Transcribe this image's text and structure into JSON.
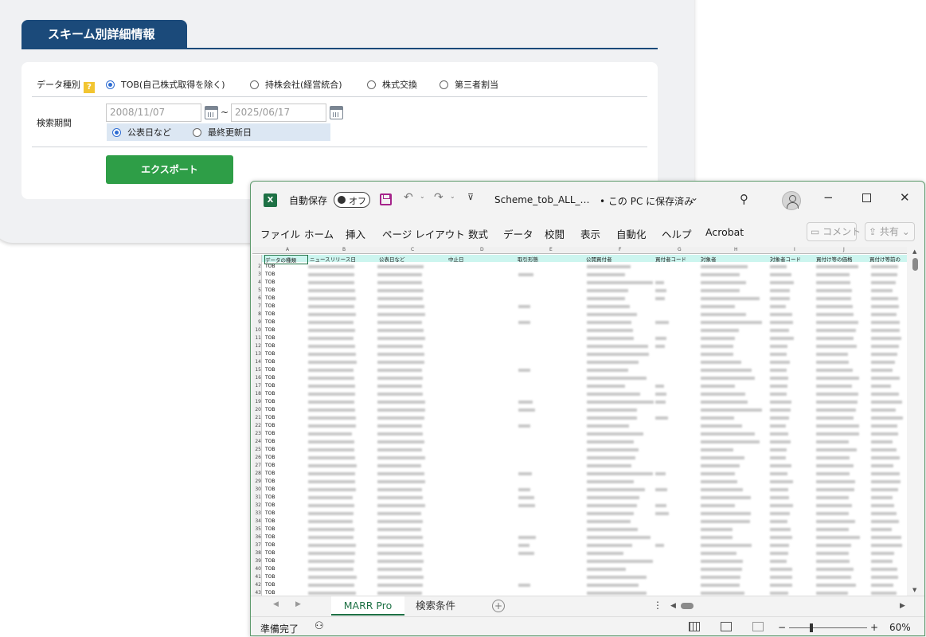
{
  "web": {
    "section_title": "スキーム別詳細情報",
    "data_type_label": "データ種別",
    "help_icon": "?",
    "data_type_options": [
      "TOB(自己株式取得を除く)",
      "持株会社(経営統合)",
      "株式交換",
      "第三者割当"
    ],
    "data_type_selected": 0,
    "period_label": "検索期間",
    "date_from": "2008/11/07",
    "date_to": "2025/06/17",
    "date_sep": "~",
    "date_type_options": [
      "公表日など",
      "最終更新日"
    ],
    "date_type_selected": 0,
    "export_label": "エクスポート",
    "accent_color": "#1b4a7a",
    "export_color": "#2e9e47"
  },
  "excel": {
    "app_icon": "X",
    "autosave_label": "自動保存",
    "autosave_state": "オフ",
    "file_name": "Scheme_tob_ALL_…",
    "save_status": "• この PC に保存済み",
    "menu": [
      "ファイル",
      "ホーム",
      "挿入",
      "ページ レイアウト",
      "数式",
      "データ",
      "校閲",
      "表示",
      "自動化",
      "ヘルプ",
      "Acrobat"
    ],
    "comment_label": "コメント",
    "share_label": "共有",
    "columns": [
      "A",
      "B",
      "C",
      "D",
      "E",
      "F",
      "G",
      "H",
      "I",
      "J"
    ],
    "headers": [
      "データの種類",
      "ニュースリリース日",
      "公表日など",
      "中止日",
      "取引形態",
      "公開買付者",
      "買付者コード",
      "対象者",
      "対象者コード",
      "買付け等の価格",
      "買付け等前の"
    ],
    "row_numbers": [
      "1",
      "2",
      "3",
      "4",
      "5",
      "6",
      "7",
      "8",
      "9",
      "10",
      "11",
      "12",
      "13",
      "14",
      "15",
      "16",
      "17",
      "18",
      "19",
      "20",
      "21",
      "22",
      "23",
      "24",
      "25",
      "26",
      "27",
      "28",
      "29",
      "30",
      "31",
      "32",
      "33",
      "34",
      "35",
      "36",
      "37",
      "38",
      "39",
      "40",
      "41",
      "42",
      "43"
    ],
    "row_value": "TOB",
    "sheet_tabs": [
      "MARR Pro",
      "検索条件"
    ],
    "active_tab": 0,
    "status_ready": "準備完了",
    "zoom": "60%",
    "zoom_minus": "−",
    "zoom_plus": "+"
  }
}
